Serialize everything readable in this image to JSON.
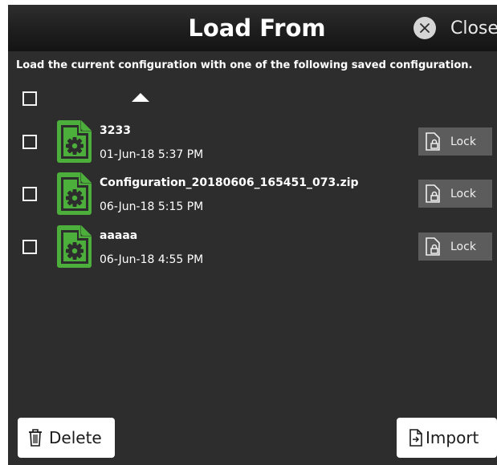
{
  "dialog": {
    "title": "Load From",
    "close_label": "Close",
    "instruction": "Load the current configuration with one of the following saved configuration."
  },
  "list": {
    "select_all_checked": false,
    "sort_direction": "ascending",
    "items": [
      {
        "name": "3233",
        "date": "01-Jun-18 5:37 PM",
        "lock_label": "Lock",
        "checked": false,
        "icon": "file-gear-icon"
      },
      {
        "name": "Configuration_20180606_165451_073.zip",
        "date": "06-Jun-18 5:15 PM",
        "lock_label": "Lock",
        "checked": false,
        "icon": "file-gear-icon"
      },
      {
        "name": "aaaaa",
        "date": "06-Jun-18 4:55 PM",
        "lock_label": "Lock",
        "checked": false,
        "icon": "file-gear-icon"
      }
    ]
  },
  "footer": {
    "delete_label": "Delete",
    "import_label": "Import"
  },
  "colors": {
    "background": "#2d2d2d",
    "file_icon_green": "#4caf3b",
    "lock_button": "#5c5c5c"
  }
}
